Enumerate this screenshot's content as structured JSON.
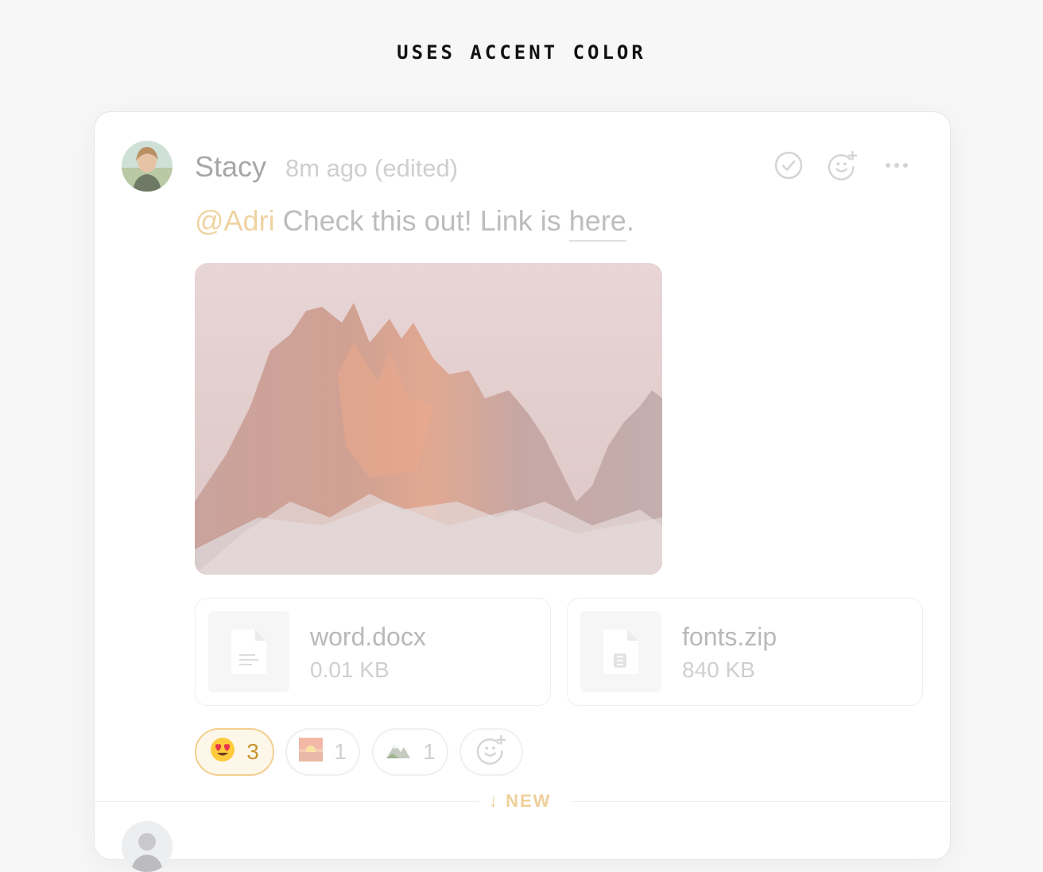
{
  "heading": "USES ACCENT COLOR",
  "message": {
    "author": "Stacy",
    "meta": "8m ago (edited)",
    "mention": "@Adri",
    "text_before_link": " Check this out! Link is ",
    "link_text": "here",
    "text_after_link": "."
  },
  "files": [
    {
      "name": "word.docx",
      "size": "0.01 KB",
      "icon": "document-icon"
    },
    {
      "name": "fonts.zip",
      "size": "840 KB",
      "icon": "zip-icon"
    }
  ],
  "reactions": [
    {
      "emoji": "heart-eyes-emoji",
      "count": "3",
      "active": true
    },
    {
      "emoji": "sunset-emoji",
      "count": "1",
      "active": false
    },
    {
      "emoji": "mountain-emoji",
      "count": "1",
      "active": false
    }
  ],
  "new_divider": "NEW",
  "colors": {
    "accent": "#f3ce8f",
    "accent_text": "#c8962f",
    "mention": "#efd3a2"
  }
}
